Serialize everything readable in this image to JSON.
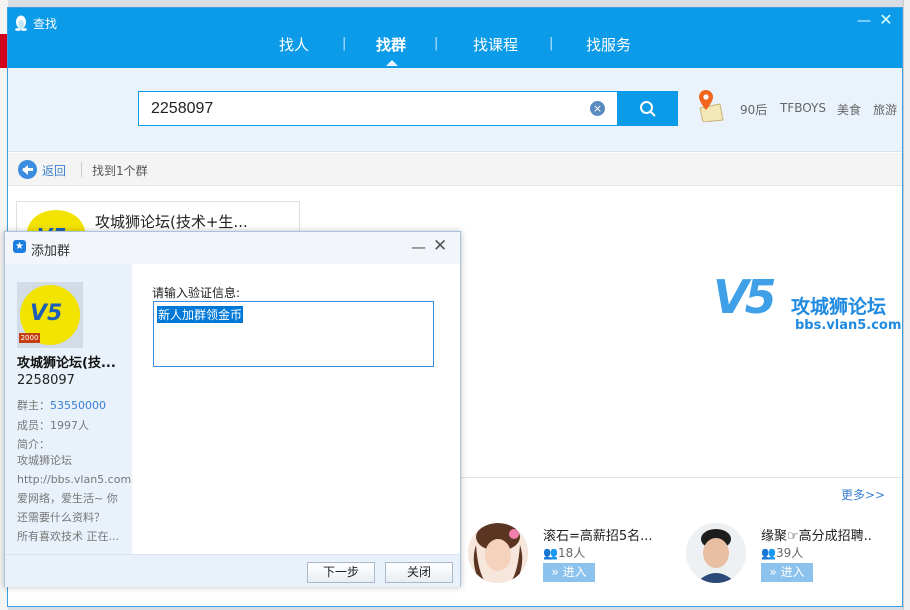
{
  "window": {
    "title": "查找",
    "nav_tabs": [
      {
        "label": "找人",
        "active": false
      },
      {
        "label": "找群",
        "active": true
      },
      {
        "label": "找课程",
        "active": false
      },
      {
        "label": "找服务",
        "active": false
      }
    ],
    "nav_separator": "|"
  },
  "search": {
    "value": "2258097",
    "hot_tags": [
      "90后",
      "TFBOYS",
      "美食",
      "旅游"
    ]
  },
  "toolbar": {
    "back_label": "返回",
    "result_text": "找到1个群"
  },
  "result_card": {
    "name": "攻城狮论坛(技术+生..."
  },
  "brand": {
    "logo": "V5",
    "name": "攻城狮论坛",
    "url": "bbs.vlan5.com"
  },
  "recommend": {
    "more_label": "更多>>",
    "items": [
      {
        "name": "滚石=高薪招5名...",
        "count": "18人",
        "join": "» 进入"
      },
      {
        "name": "缘聚☞高分成招聘..",
        "count": "39人",
        "join": "» 进入"
      }
    ]
  },
  "dialog": {
    "title": "添加群",
    "group_name": "攻城狮论坛(技...",
    "group_id": "2258097",
    "badge": "2000",
    "owner_label": "群主：",
    "owner_value": "53550000",
    "members": "成员：1997人",
    "intro_label": "简介：",
    "intro_lines": [
      "攻城狮论坛",
      "http://bbs.vlan5.com",
      "爱网络，爱生活~ 你",
      "还需要什么资料？",
      "所有喜欢技术 正在..."
    ],
    "prompt": "请输入验证信息:",
    "verify_text": "新人加群领金币",
    "next_label": "下一步",
    "close_label": "关闭"
  },
  "colors": {
    "titlebar": "#0c9be8",
    "search_bg": "#eaf3fb",
    "link": "#3b7fd0"
  }
}
